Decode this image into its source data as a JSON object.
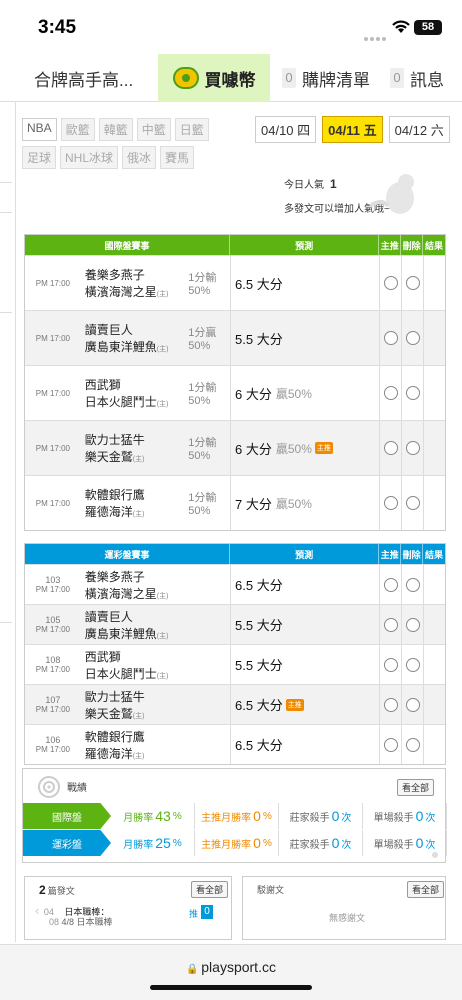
{
  "status": {
    "time": "3:45",
    "battery": "58"
  },
  "tabs": {
    "tab1": "合牌高手高...",
    "tab2": "買噱幣",
    "tab3_count": "0",
    "tab3": "購牌清單",
    "tab4_count": "0",
    "tab4": "訊息"
  },
  "filters": {
    "row1": [
      "NBA",
      "歐籃",
      "韓籃",
      "中籃",
      "日籃"
    ],
    "row2": [
      "足球",
      "NHL冰球",
      "俄冰",
      "賽馬"
    ],
    "dates": [
      "04/10 四",
      "04/11 五",
      "04/12 六"
    ],
    "active_date": "04/11 五"
  },
  "popularity": {
    "label": "今日人氣",
    "value": "1",
    "hint": "多發文可以增加人氣哦~"
  },
  "intl_table": {
    "headers": [
      "國際盤賽事",
      "預測",
      "主推",
      "刪除",
      "結果"
    ],
    "rows": [
      {
        "time": "PM 17:00",
        "away": "養樂多燕子",
        "home": "橫濱海灣之星",
        "line1": "1分輸",
        "line2": "50%",
        "pred": "6.5 大分",
        "extra": "",
        "tag": ""
      },
      {
        "time": "PM 17:00",
        "away": "讀賣巨人",
        "home": "廣島東洋鯉魚",
        "line1": "1分贏",
        "line2": "50%",
        "pred": "5.5 大分",
        "extra": "",
        "tag": ""
      },
      {
        "time": "PM 17:00",
        "away": "西武獅",
        "home": "日本火腿鬥士",
        "line1": "1分輸",
        "line2": "50%",
        "pred": "6 大分",
        "extra": "贏50%",
        "tag": ""
      },
      {
        "time": "PM 17:00",
        "away": "歐力士猛牛",
        "home": "樂天金鷲",
        "line1": "1分輸",
        "line2": "50%",
        "pred": "6 大分",
        "extra": "贏50%",
        "tag": "主推"
      },
      {
        "time": "PM 17:00",
        "away": "軟體銀行鷹",
        "home": "羅德海洋",
        "line1": "1分輸",
        "line2": "50%",
        "pred": "7 大分",
        "extra": "贏50%",
        "tag": ""
      }
    ]
  },
  "lottery_table": {
    "headers": [
      "運彩盤賽事",
      "預測",
      "主推",
      "刪除",
      "結果"
    ],
    "rows": [
      {
        "num": "103",
        "time": "PM 17:00",
        "away": "養樂多燕子",
        "home": "橫濱海灣之星",
        "pred": "6.5 大分",
        "tag": ""
      },
      {
        "num": "105",
        "time": "PM 17:00",
        "away": "讀賣巨人",
        "home": "廣島東洋鯉魚",
        "pred": "5.5 大分",
        "tag": ""
      },
      {
        "num": "108",
        "time": "PM 17:00",
        "away": "西武獅",
        "home": "日本火腿鬥士",
        "pred": "5.5 大分",
        "tag": ""
      },
      {
        "num": "107",
        "time": "PM 17:00",
        "away": "歐力士猛牛",
        "home": "樂天金鷲",
        "pred": "6.5 大分",
        "tag": "主推"
      },
      {
        "num": "106",
        "time": "PM 17:00",
        "away": "軟體銀行鷹",
        "home": "羅德海洋",
        "pred": "6.5 大分",
        "tag": ""
      }
    ]
  },
  "home_mark": "(主)",
  "record": {
    "title": "戰績",
    "all_btn": "看全部",
    "rows": [
      {
        "label": "國際盤",
        "color": "#5cb312",
        "c1_label": "月勝率",
        "c1_val": "43",
        "c1_unit": "%",
        "c2_label": "主推月勝率",
        "c2_val": "0",
        "c2_unit": "%",
        "c3_label": "莊家殺手",
        "c3_val": "0",
        "c3_unit": "次",
        "c4_label": "單場殺手",
        "c4_val": "0",
        "c4_unit": "次"
      },
      {
        "label": "運彩盤",
        "color": "#0099d9",
        "c1_label": "月勝率",
        "c1_val": "25",
        "c1_unit": "%",
        "c2_label": "主推月勝率",
        "c2_val": "0",
        "c2_unit": "%",
        "c3_label": "莊家殺手",
        "c3_val": "0",
        "c3_unit": "次",
        "c4_label": "單場殺手",
        "c4_val": "0",
        "c4_unit": "次"
      }
    ]
  },
  "posts": {
    "count": "2",
    "label": "篇發文",
    "all_btn": "看全部",
    "item_date": "04",
    "item_date2": "08",
    "item_title": "日本職棒：",
    "item_sub": "4/8 日本職棒",
    "item_push_label": "推",
    "item_push": "0"
  },
  "rebuttal": {
    "label": "駁謝文",
    "all_btn": "看全部",
    "empty": "無感謝文"
  },
  "browser": {
    "url": "playsport.cc"
  }
}
